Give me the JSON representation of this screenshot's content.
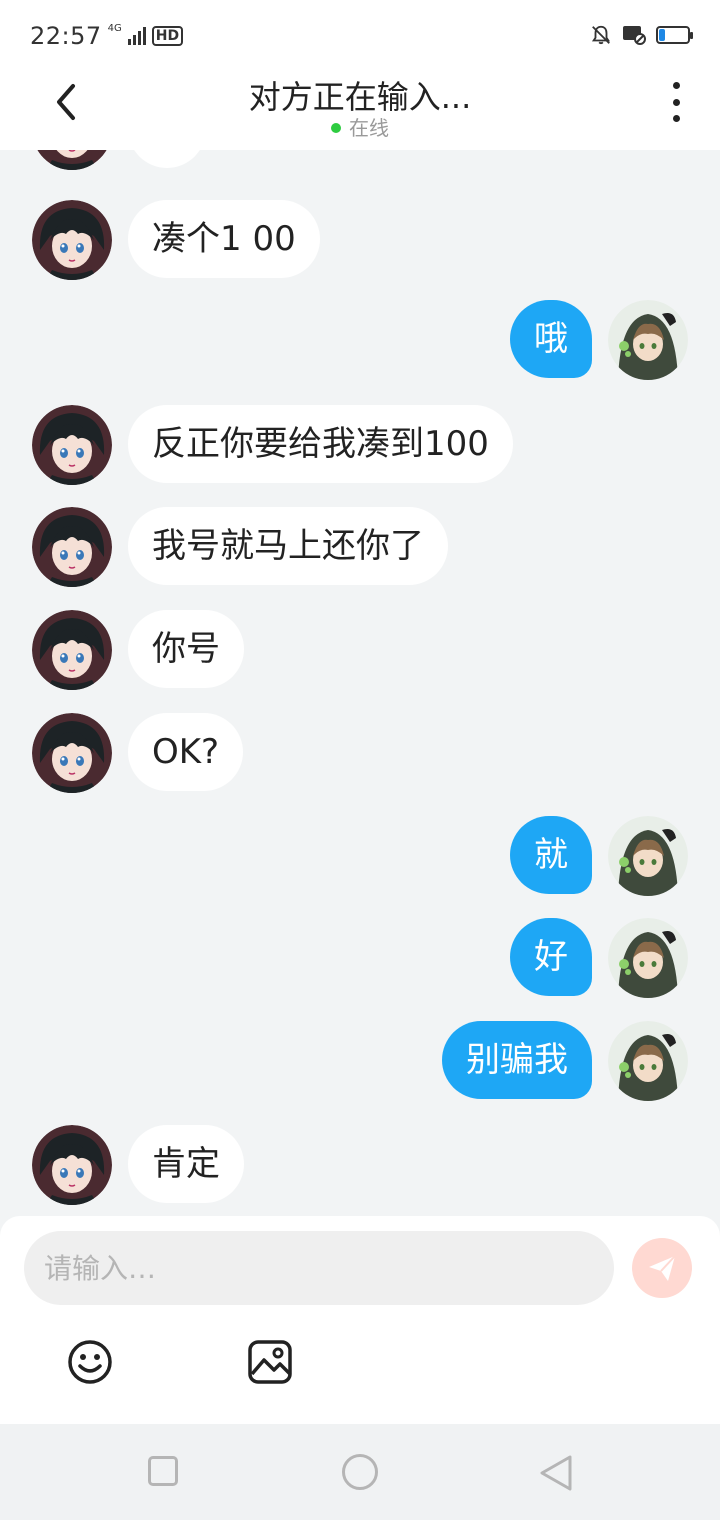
{
  "status_bar": {
    "time": "22:57",
    "network": "4G",
    "hd_label": "HD",
    "battery_level": 0.2,
    "battery_color": "#1e88e5"
  },
  "header": {
    "back_icon": "chevron-left-icon",
    "title": "对方正在输入...",
    "status": "在线",
    "status_color": "#2ecc40",
    "menu_icon": "more-vertical-icon"
  },
  "messages": [
    {
      "side": "recv",
      "text": "凑个1 00"
    },
    {
      "side": "sent",
      "text": "哦"
    },
    {
      "side": "recv",
      "text": "反正你要给我凑到100"
    },
    {
      "side": "recv",
      "text": "我号就马上还你了"
    },
    {
      "side": "recv",
      "text": "你号"
    },
    {
      "side": "recv",
      "text": "OK?"
    },
    {
      "side": "sent",
      "text": "就"
    },
    {
      "side": "sent",
      "text": "好"
    },
    {
      "side": "sent",
      "text": "别骗我"
    },
    {
      "side": "recv",
      "text": "肯定"
    }
  ],
  "composer": {
    "placeholder": "请输入…",
    "value": "",
    "send_icon": "send-icon",
    "emoji_icon": "emoji-icon",
    "image_icon": "image-icon",
    "send_color": "#ffd9d2"
  },
  "colors": {
    "sent_bubble": "#1ea7f5",
    "received_bubble": "#ffffff",
    "background": "#f2f4f5"
  },
  "nav": {
    "recent_icon": "square-icon",
    "home_icon": "circle-icon",
    "back_icon": "triangle-back-icon"
  }
}
